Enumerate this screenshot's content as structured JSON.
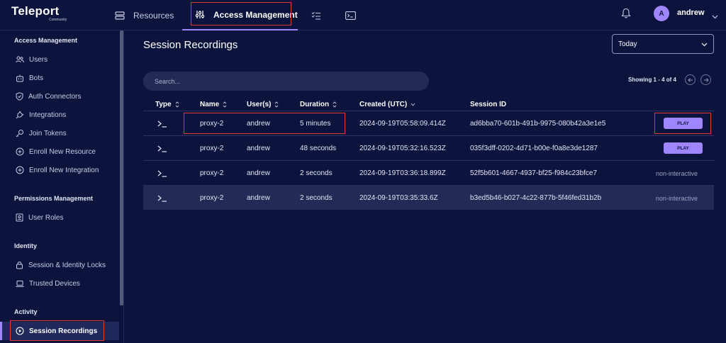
{
  "brand": {
    "name": "Teleport",
    "edition": "Community"
  },
  "topnav": {
    "resources_label": "Resources",
    "access_label": "Access Management",
    "checks_icon": "checklist-icon",
    "terminal_icon": "terminal-icon"
  },
  "user": {
    "initial": "A",
    "name": "andrew"
  },
  "sidebar": {
    "sections": [
      {
        "title": "Access Management",
        "items": [
          "Users",
          "Bots",
          "Auth Connectors",
          "Integrations",
          "Join Tokens",
          "Enroll New Resource",
          "Enroll New Integration"
        ]
      },
      {
        "title": "Permissions Management",
        "items": [
          "User Roles"
        ]
      },
      {
        "title": "Identity",
        "items": [
          "Session & Identity Locks",
          "Trusted Devices"
        ]
      },
      {
        "title": "Activity",
        "items": [
          "Session Recordings"
        ]
      }
    ],
    "active_item": "Session Recordings"
  },
  "main": {
    "title": "Session Recordings",
    "range": "Today",
    "search_placeholder": "Search...",
    "showing": "Showing 1 - 4 of 4",
    "columns": [
      "Type",
      "Name",
      "User(s)",
      "Duration",
      "Created (UTC)",
      "Session ID"
    ],
    "rows": [
      {
        "type": ">_",
        "name": "proxy-2",
        "user": "andrew",
        "duration": "5 minutes",
        "created": "2024-09-19T05:58:09.414Z",
        "session_id": "ad6bba70-601b-491b-9975-080b42a3e1e5",
        "action": "PLAY"
      },
      {
        "type": ">_",
        "name": "proxy-2",
        "user": "andrew",
        "duration": "48 seconds",
        "created": "2024-09-19T05:32:16.523Z",
        "session_id": "035f3dff-0202-4d71-b00e-f0a8e3de1287",
        "action": "PLAY"
      },
      {
        "type": ">_",
        "name": "proxy-2",
        "user": "andrew",
        "duration": "2 seconds",
        "created": "2024-09-19T03:36:18.899Z",
        "session_id": "52f5b601-4667-4937-bf25-f984c23bfce7",
        "action": "non-interactive"
      },
      {
        "type": ">_",
        "name": "proxy-2",
        "user": "andrew",
        "duration": "2 seconds",
        "created": "2024-09-19T03:35:33.6Z",
        "session_id": "b3ed5b46-b027-4c22-877b-5f46fed31b2b",
        "action": "non-interactive"
      }
    ]
  },
  "colors": {
    "background": "#0c143d",
    "accent": "#9f85ff",
    "row_alt": "#222a55",
    "highlight": "#e53935"
  }
}
